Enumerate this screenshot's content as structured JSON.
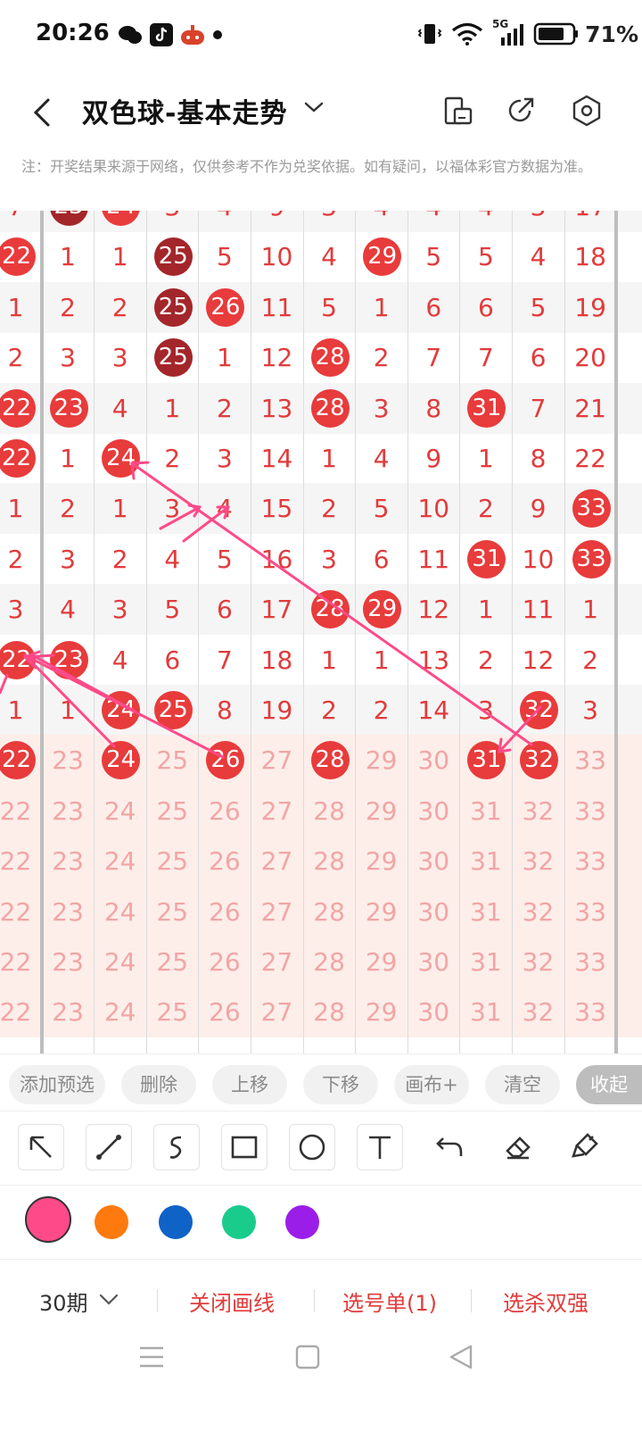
{
  "status": {
    "time": "20:26",
    "network": "5G",
    "battery": "71%"
  },
  "header": {
    "title": "双色球-基本走势"
  },
  "notice": "注：开奖结果来源于网络，仅供参考不作为兑奖依据。如有疑问，以福体彩官方数据为准。",
  "chart": {
    "rows": [
      [
        {
          "v": "7"
        },
        {
          "v": "23",
          "b": "dark"
        },
        {
          "v": "24",
          "b": "red"
        },
        {
          "v": "3"
        },
        {
          "v": "4"
        },
        {
          "v": "9"
        },
        {
          "v": "3"
        },
        {
          "v": "4"
        },
        {
          "v": "4"
        },
        {
          "v": "4"
        },
        {
          "v": "3"
        },
        {
          "v": "17"
        }
      ],
      [
        {
          "v": "22",
          "b": "red"
        },
        {
          "v": "1"
        },
        {
          "v": "1"
        },
        {
          "v": "25",
          "b": "dark"
        },
        {
          "v": "5"
        },
        {
          "v": "10"
        },
        {
          "v": "4"
        },
        {
          "v": "29",
          "b": "red"
        },
        {
          "v": "5"
        },
        {
          "v": "5"
        },
        {
          "v": "4"
        },
        {
          "v": "18"
        }
      ],
      [
        {
          "v": "1"
        },
        {
          "v": "2"
        },
        {
          "v": "2"
        },
        {
          "v": "25",
          "b": "dark"
        },
        {
          "v": "26",
          "b": "red"
        },
        {
          "v": "11"
        },
        {
          "v": "5"
        },
        {
          "v": "1"
        },
        {
          "v": "6"
        },
        {
          "v": "6"
        },
        {
          "v": "5"
        },
        {
          "v": "19"
        }
      ],
      [
        {
          "v": "2"
        },
        {
          "v": "3"
        },
        {
          "v": "3"
        },
        {
          "v": "25",
          "b": "dark"
        },
        {
          "v": "1"
        },
        {
          "v": "12"
        },
        {
          "v": "28",
          "b": "red"
        },
        {
          "v": "2"
        },
        {
          "v": "7"
        },
        {
          "v": "7"
        },
        {
          "v": "6"
        },
        {
          "v": "20"
        }
      ],
      [
        {
          "v": "22",
          "b": "red"
        },
        {
          "v": "23",
          "b": "red"
        },
        {
          "v": "4"
        },
        {
          "v": "1"
        },
        {
          "v": "2"
        },
        {
          "v": "13"
        },
        {
          "v": "28",
          "b": "red"
        },
        {
          "v": "3"
        },
        {
          "v": "8"
        },
        {
          "v": "31",
          "b": "red"
        },
        {
          "v": "7"
        },
        {
          "v": "21"
        }
      ],
      [
        {
          "v": "22",
          "b": "red"
        },
        {
          "v": "1"
        },
        {
          "v": "24",
          "b": "red"
        },
        {
          "v": "2"
        },
        {
          "v": "3"
        },
        {
          "v": "14"
        },
        {
          "v": "1"
        },
        {
          "v": "4"
        },
        {
          "v": "9"
        },
        {
          "v": "1"
        },
        {
          "v": "8"
        },
        {
          "v": "22"
        }
      ],
      [
        {
          "v": "1"
        },
        {
          "v": "2"
        },
        {
          "v": "1"
        },
        {
          "v": "3"
        },
        {
          "v": "4"
        },
        {
          "v": "15"
        },
        {
          "v": "2"
        },
        {
          "v": "5"
        },
        {
          "v": "10"
        },
        {
          "v": "2"
        },
        {
          "v": "9"
        },
        {
          "v": "33",
          "b": "red"
        }
      ],
      [
        {
          "v": "2"
        },
        {
          "v": "3"
        },
        {
          "v": "2"
        },
        {
          "v": "4"
        },
        {
          "v": "5"
        },
        {
          "v": "16"
        },
        {
          "v": "3"
        },
        {
          "v": "6"
        },
        {
          "v": "11"
        },
        {
          "v": "31",
          "b": "red"
        },
        {
          "v": "10"
        },
        {
          "v": "33",
          "b": "red"
        }
      ],
      [
        {
          "v": "3"
        },
        {
          "v": "4"
        },
        {
          "v": "3"
        },
        {
          "v": "5"
        },
        {
          "v": "6"
        },
        {
          "v": "17"
        },
        {
          "v": "28",
          "b": "red"
        },
        {
          "v": "29",
          "b": "red"
        },
        {
          "v": "12"
        },
        {
          "v": "1"
        },
        {
          "v": "11"
        },
        {
          "v": "1"
        }
      ],
      [
        {
          "v": "22",
          "b": "red"
        },
        {
          "v": "23",
          "b": "red"
        },
        {
          "v": "4"
        },
        {
          "v": "6"
        },
        {
          "v": "7"
        },
        {
          "v": "18"
        },
        {
          "v": "1"
        },
        {
          "v": "1"
        },
        {
          "v": "13"
        },
        {
          "v": "2"
        },
        {
          "v": "12"
        },
        {
          "v": "2"
        }
      ],
      [
        {
          "v": "1"
        },
        {
          "v": "1"
        },
        {
          "v": "24",
          "b": "red"
        },
        {
          "v": "25",
          "b": "red"
        },
        {
          "v": "8"
        },
        {
          "v": "19"
        },
        {
          "v": "2"
        },
        {
          "v": "2"
        },
        {
          "v": "14"
        },
        {
          "v": "3"
        },
        {
          "v": "32",
          "b": "red"
        },
        {
          "v": "3"
        }
      ],
      [
        {
          "v": "22",
          "b": "red"
        },
        {
          "v": "23",
          "f": 1
        },
        {
          "v": "24",
          "b": "red"
        },
        {
          "v": "25",
          "f": 1
        },
        {
          "v": "26",
          "b": "red"
        },
        {
          "v": "27",
          "f": 1
        },
        {
          "v": "28",
          "b": "red"
        },
        {
          "v": "29",
          "f": 1
        },
        {
          "v": "30",
          "f": 1
        },
        {
          "v": "31",
          "b": "red"
        },
        {
          "v": "32",
          "b": "red"
        },
        {
          "v": "33",
          "f": 1
        }
      ],
      [
        {
          "v": "22",
          "f": 1
        },
        {
          "v": "23",
          "f": 1
        },
        {
          "v": "24",
          "f": 1
        },
        {
          "v": "25",
          "f": 1
        },
        {
          "v": "26",
          "f": 1
        },
        {
          "v": "27",
          "f": 1
        },
        {
          "v": "28",
          "f": 1
        },
        {
          "v": "29",
          "f": 1
        },
        {
          "v": "30",
          "f": 1
        },
        {
          "v": "31",
          "f": 1
        },
        {
          "v": "32",
          "f": 1
        },
        {
          "v": "33",
          "f": 1
        }
      ],
      [
        {
          "v": "22",
          "f": 1
        },
        {
          "v": "23",
          "f": 1
        },
        {
          "v": "24",
          "f": 1
        },
        {
          "v": "25",
          "f": 1
        },
        {
          "v": "26",
          "f": 1
        },
        {
          "v": "27",
          "f": 1
        },
        {
          "v": "28",
          "f": 1
        },
        {
          "v": "29",
          "f": 1
        },
        {
          "v": "30",
          "f": 1
        },
        {
          "v": "31",
          "f": 1
        },
        {
          "v": "32",
          "f": 1
        },
        {
          "v": "33",
          "f": 1
        }
      ],
      [
        {
          "v": "22",
          "f": 1
        },
        {
          "v": "23",
          "f": 1
        },
        {
          "v": "24",
          "f": 1
        },
        {
          "v": "25",
          "f": 1
        },
        {
          "v": "26",
          "f": 1
        },
        {
          "v": "27",
          "f": 1
        },
        {
          "v": "28",
          "f": 1
        },
        {
          "v": "29",
          "f": 1
        },
        {
          "v": "30",
          "f": 1
        },
        {
          "v": "31",
          "f": 1
        },
        {
          "v": "32",
          "f": 1
        },
        {
          "v": "33",
          "f": 1
        }
      ],
      [
        {
          "v": "22",
          "f": 1
        },
        {
          "v": "23",
          "f": 1
        },
        {
          "v": "24",
          "f": 1
        },
        {
          "v": "25",
          "f": 1
        },
        {
          "v": "26",
          "f": 1
        },
        {
          "v": "27",
          "f": 1
        },
        {
          "v": "28",
          "f": 1
        },
        {
          "v": "29",
          "f": 1
        },
        {
          "v": "30",
          "f": 1
        },
        {
          "v": "31",
          "f": 1
        },
        {
          "v": "32",
          "f": 1
        },
        {
          "v": "33",
          "f": 1
        }
      ],
      [
        {
          "v": "22",
          "f": 1
        },
        {
          "v": "23",
          "f": 1
        },
        {
          "v": "24",
          "f": 1
        },
        {
          "v": "25",
          "f": 1
        },
        {
          "v": "26",
          "f": 1
        },
        {
          "v": "27",
          "f": 1
        },
        {
          "v": "28",
          "f": 1
        },
        {
          "v": "29",
          "f": 1
        },
        {
          "v": "30",
          "f": 1
        },
        {
          "v": "31",
          "f": 1
        },
        {
          "v": "32",
          "f": 1
        },
        {
          "v": "33",
          "f": 1
        }
      ]
    ],
    "colors": {
      "ball": "#e83b3b",
      "ball_dark": "#a3262a",
      "text": "#e23b3b",
      "faint_text": "#f2a5a5",
      "alt_row": "#f5f5f5",
      "predict_bg": "#fdeeea",
      "drawing": "#ff4a8a"
    }
  },
  "actions_row": {
    "add_preselect": "添加预选",
    "delete": "删除",
    "move_up": "上移",
    "move_down": "下移",
    "canvas_plus": "画布+",
    "clear": "清空",
    "collapse": "收起"
  },
  "tools": [
    "arrow-icon",
    "line-icon",
    "curve-icon",
    "rectangle-icon",
    "circle-icon",
    "text-icon",
    "undo-icon",
    "eraser-icon",
    "brush-clear-icon"
  ],
  "palette": [
    "#ff4a8a",
    "#ff7a0e",
    "#0f62c6",
    "#19cc8c",
    "#9b1ee8"
  ],
  "bottom": {
    "period": "30期",
    "close_drawing": "关闭画线",
    "selection_list": "选号单(1)",
    "kill_double": "选杀双强"
  }
}
